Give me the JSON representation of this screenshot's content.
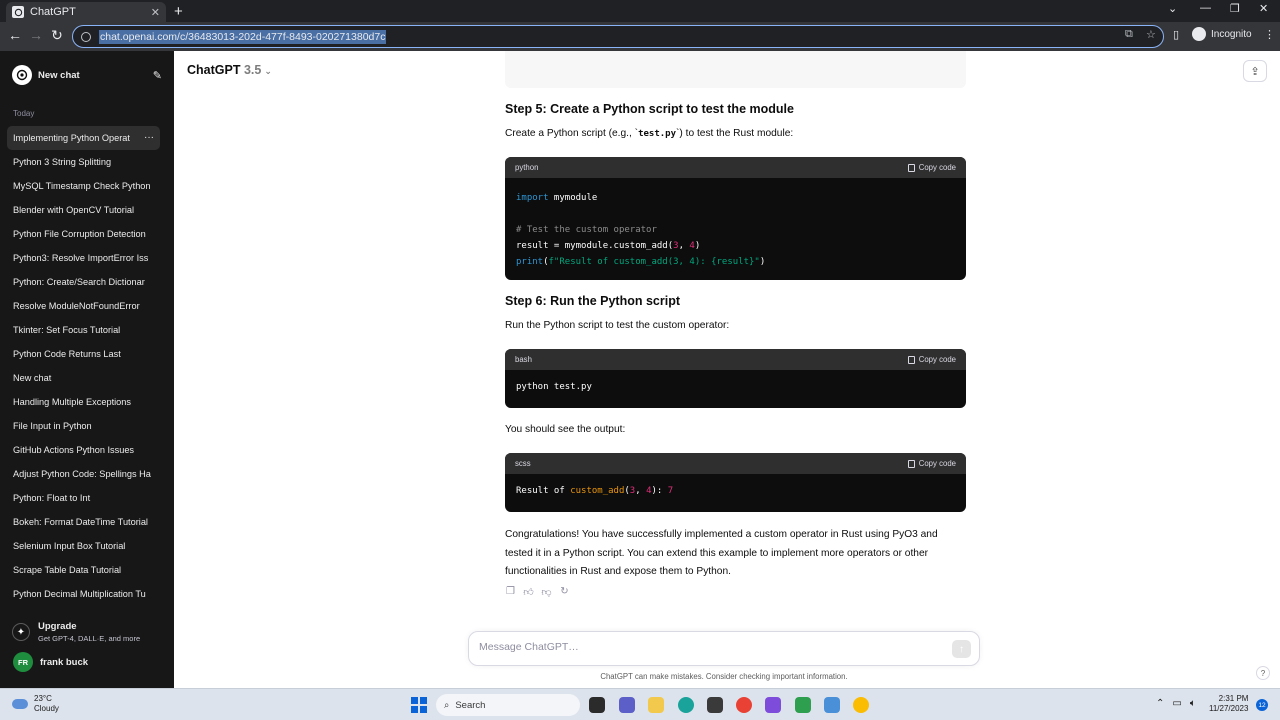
{
  "browser": {
    "tab_title": "ChatGPT",
    "tab_close": "✕",
    "new_tab": "+",
    "url": "chat.openai.com/c/36483013-202d-477f-8493-020271380d7c",
    "incognito_label": "Incognito"
  },
  "sidebar": {
    "new_chat": "New chat",
    "section_today": "Today",
    "items": [
      "Implementing Python Operat",
      "Python 3 String Splitting",
      "MySQL Timestamp Check Python",
      "Blender with OpenCV Tutorial",
      "Python File Corruption Detection",
      "Python3: Resolve ImportError Iss",
      "Python: Create/Search Dictionar",
      "Resolve ModuleNotFoundError",
      "Tkinter: Set Focus Tutorial",
      "Python Code Returns Last",
      "New chat",
      "Handling Multiple Exceptions",
      "File Input in Python",
      "GitHub Actions Python Issues",
      "Adjust Python Code: Spellings Ha",
      "Python: Float to Int",
      "Bokeh: Format DateTime Tutorial",
      "Selenium Input Box Tutorial",
      "Scrape Table Data Tutorial",
      "Python Decimal Multiplication Tu"
    ],
    "active_index": 0,
    "upgrade_title": "Upgrade",
    "upgrade_sub": "Get GPT-4, DALL·E, and more",
    "user_initials": "FR",
    "user_name": "frank buck"
  },
  "header": {
    "model_name": "ChatGPT",
    "model_version": "3.5"
  },
  "message": {
    "step5_title": "Step 5: Create a Python script to test the module",
    "step5_text_pre": "Create a Python script (e.g., `",
    "step5_code": "test.py",
    "step5_text_post": "`) to test the Rust module:",
    "code1_lang": "python",
    "copy_label": "Copy code",
    "step6_title": "Step 6: Run the Python script",
    "step6_text": "Run the Python script to test the custom operator:",
    "code2_lang": "bash",
    "code2_line": "python test.py",
    "output_text": "You should see the output:",
    "code3_lang": "scss",
    "final_line1": "Congratulations! You have successfully implemented a custom operator in Rust using PyO3 and",
    "final_line2": "tested it in a Python script. You can extend this example to implement more operators or other",
    "final_line3": "functionalities in Rust and expose them to Python."
  },
  "composer": {
    "placeholder": "Message ChatGPT…",
    "disclaimer": "ChatGPT can make mistakes. Consider checking important information.",
    "help": "?"
  },
  "taskbar": {
    "temperature": "23°C",
    "weather": "Cloudy",
    "search_label": "Search",
    "time": "2:31 PM",
    "date": "11/27/2023",
    "notification_count": "12"
  }
}
